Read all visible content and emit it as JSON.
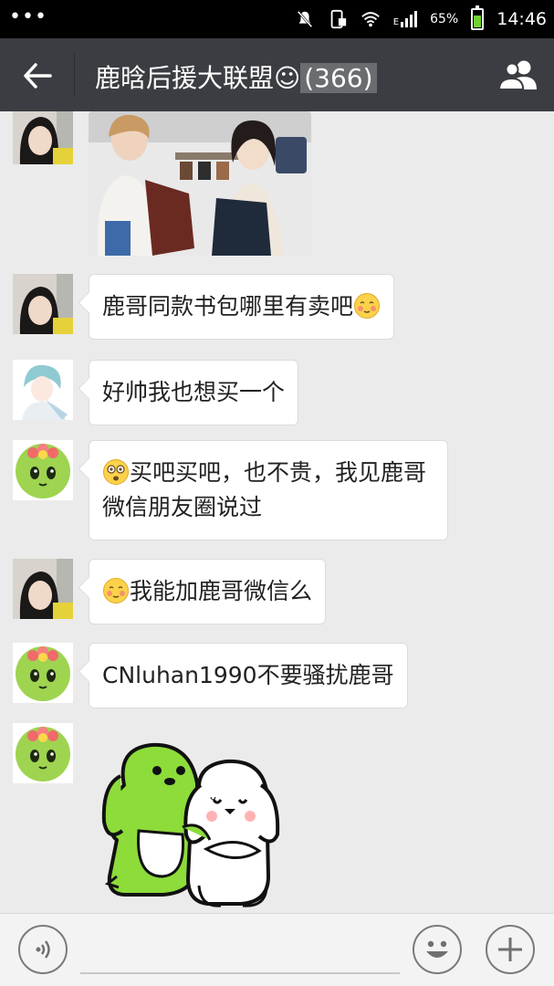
{
  "status_bar": {
    "dots": "•••",
    "network_label": "E",
    "battery_percent": "65%",
    "battery_level": 0.65,
    "time": "14:46"
  },
  "header": {
    "title": "鹿晗后援大联盟☺",
    "member_count": "(366)"
  },
  "messages": [
    {
      "type": "image",
      "sender_avatar": "avatar-girl-photo"
    },
    {
      "type": "text",
      "sender_avatar": "avatar-girl-photo",
      "text": "鹿哥同款书包哪里有卖吧",
      "emoji_after": "blush-emoji"
    },
    {
      "type": "text",
      "sender_avatar": "avatar-anime-boy",
      "text": "好帅我也想买一个"
    },
    {
      "type": "text",
      "sender_avatar": "avatar-green-flower",
      "emoji_before": "dizzy-emoji",
      "text": "买吧买吧，也不贵，我见鹿哥微信朋友圈说过"
    },
    {
      "type": "text",
      "sender_avatar": "avatar-girl-photo",
      "emoji_before": "blush-emoji",
      "text": "我能加鹿哥微信么"
    },
    {
      "type": "text",
      "sender_avatar": "avatar-green-flower",
      "text": "CNluhan1990不要骚扰鹿哥"
    },
    {
      "type": "sticker",
      "sender_avatar": "avatar-green-flower",
      "sticker": "green-dog-and-white-dog-sticker"
    }
  ],
  "input_bar": {
    "voice_icon": "voice-icon",
    "emoji_icon": "smiley-icon",
    "plus_icon": "plus-icon",
    "placeholder": ""
  },
  "colors": {
    "titlebar": "#3b3d42",
    "background": "#ebebeb",
    "bubble": "#ffffff"
  }
}
